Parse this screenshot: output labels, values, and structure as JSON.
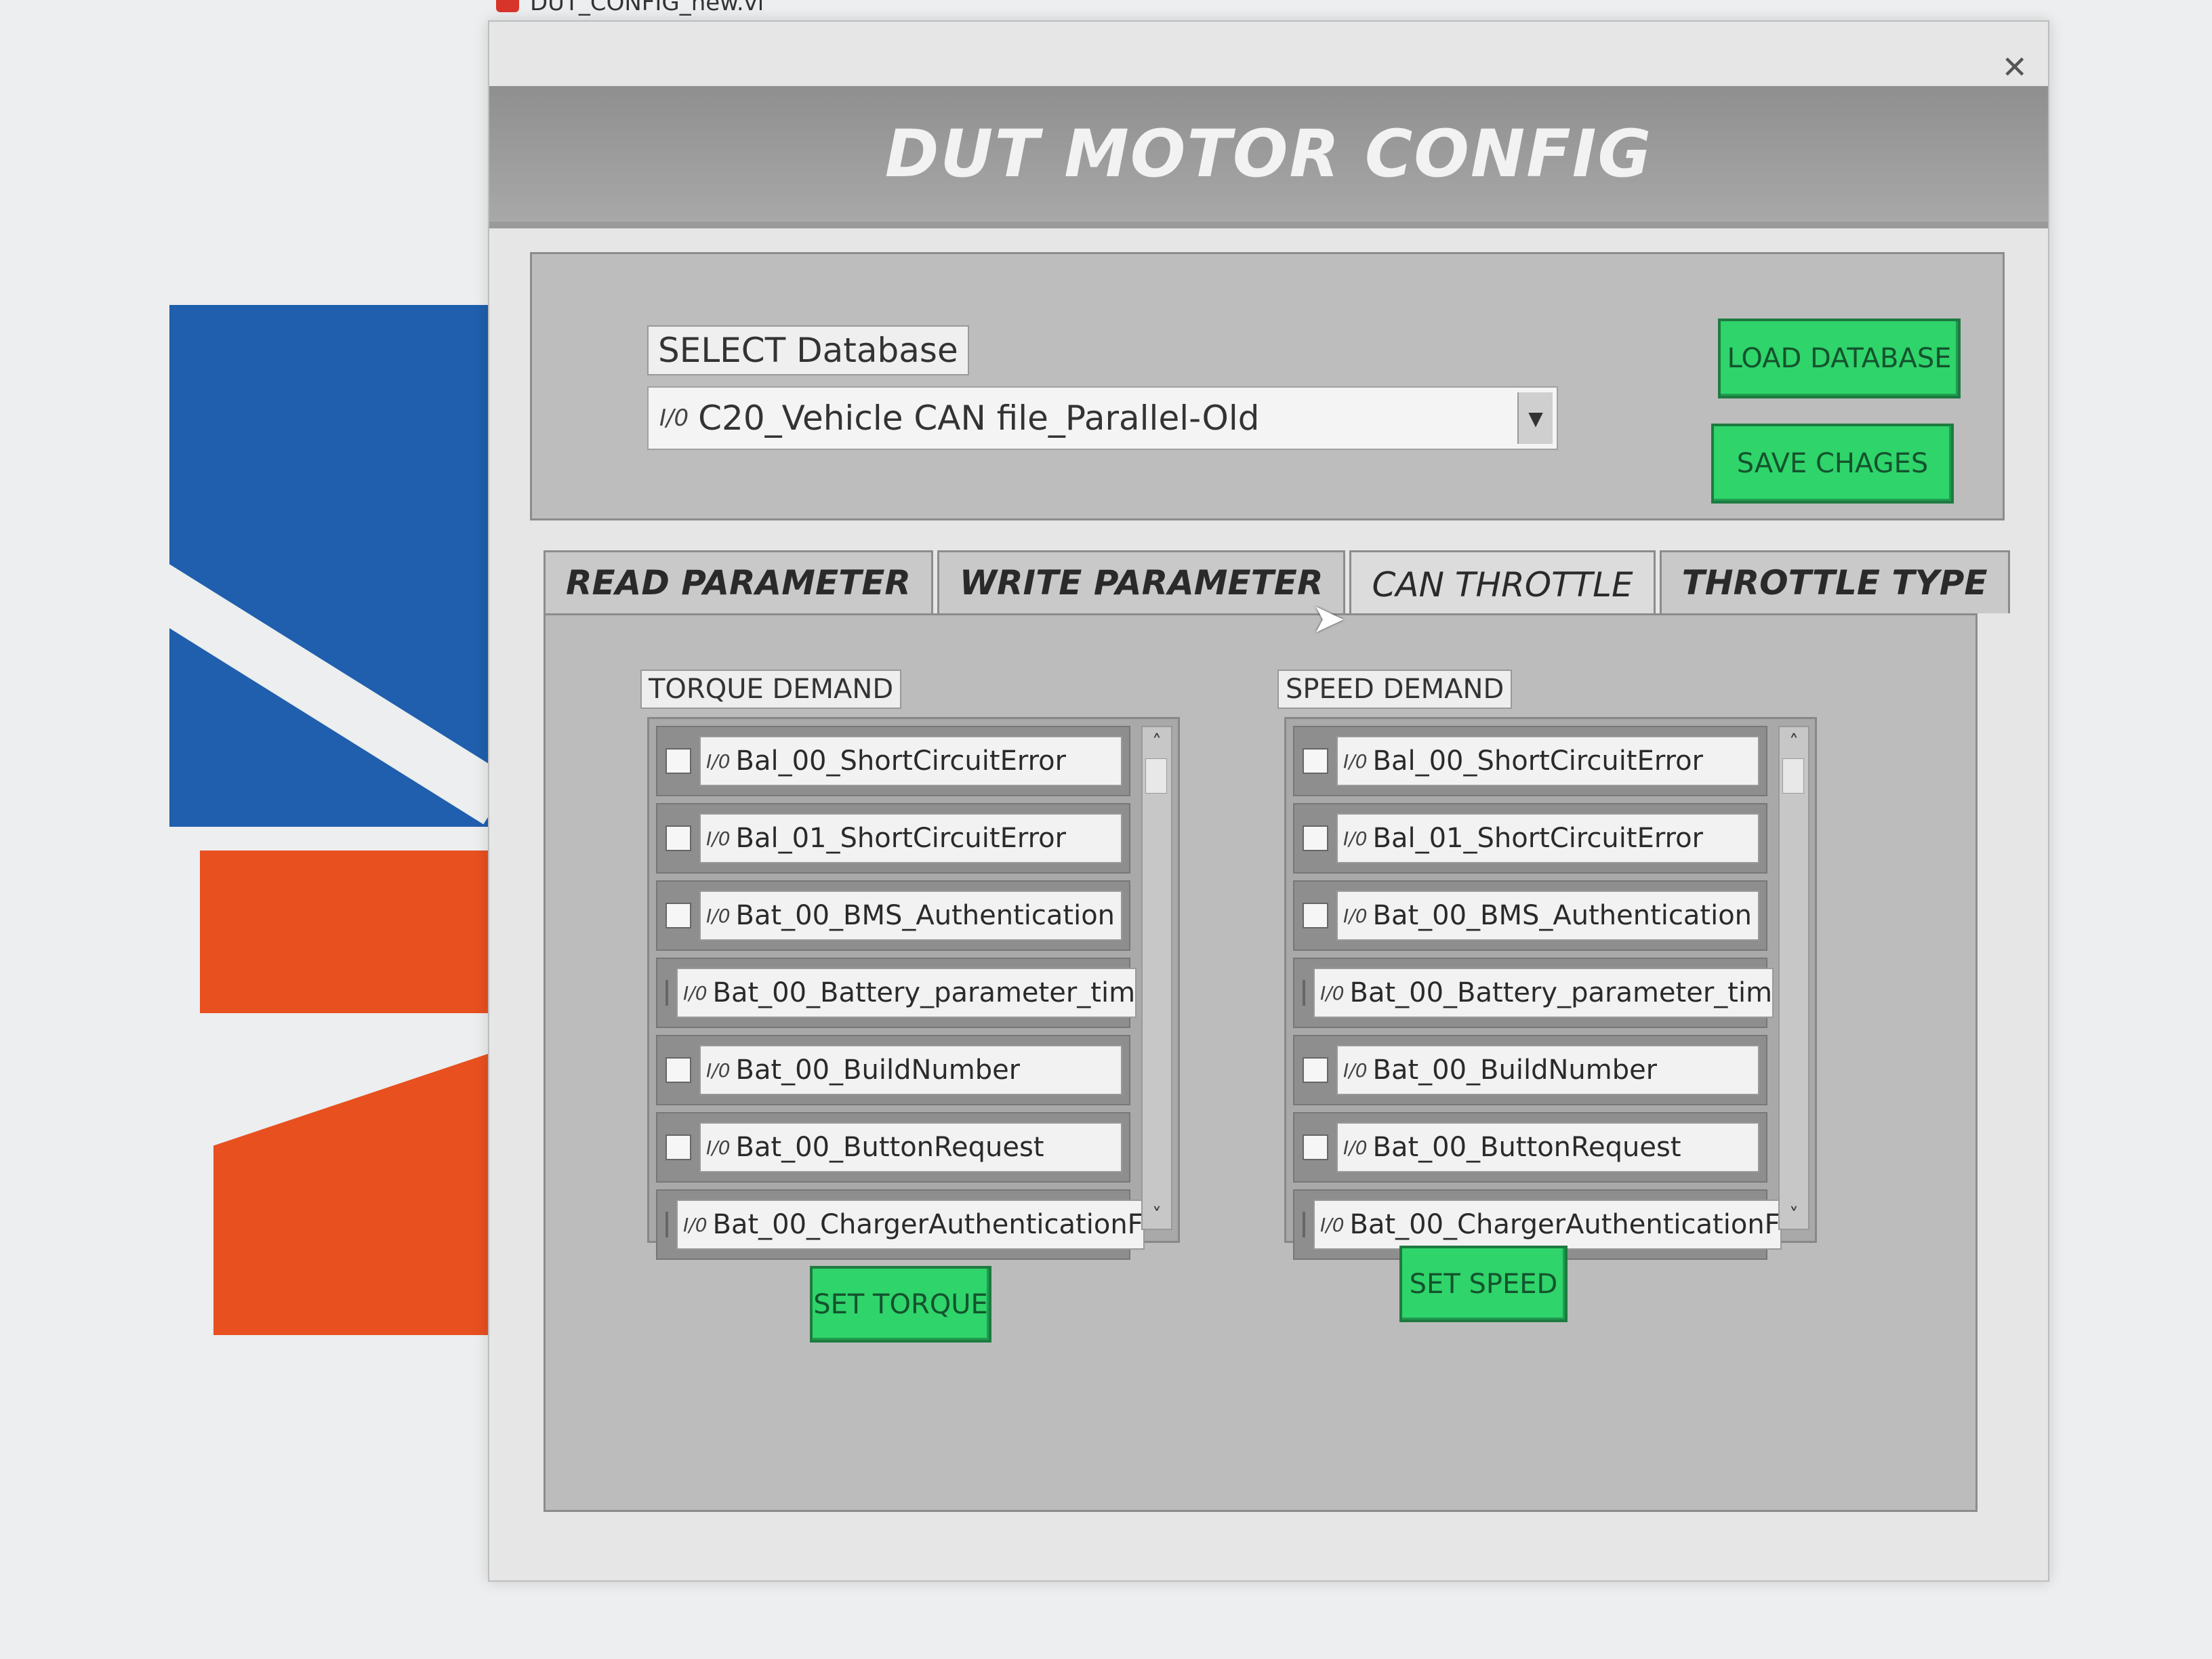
{
  "window": {
    "title": "DUT_CONFIG_new.vi",
    "close_icon": "close-icon"
  },
  "banner": {
    "title": "DUT MOTOR CONFIG"
  },
  "database": {
    "label": "SELECT Database",
    "selected": "C20_Vehicle CAN file_Parallel-Old",
    "load_label": "LOAD DATABASE",
    "save_label": "SAVE CHAGES"
  },
  "tabs": [
    {
      "label": "READ PARAMETER",
      "active": false
    },
    {
      "label": "WRITE PARAMETER",
      "active": false
    },
    {
      "label": "CAN THROTTLE",
      "active": true
    },
    {
      "label": "THROTTLE TYPE",
      "active": false
    }
  ],
  "torque": {
    "label": "TORQUE DEMAND",
    "items": [
      "Bal_00_ShortCircuitError",
      "Bal_01_ShortCircuitError",
      "Bat_00_BMS_Authentication",
      "Bat_00_Battery_parameter_tim",
      "Bat_00_BuildNumber",
      "Bat_00_ButtonRequest",
      "Bat_00_ChargerAuthenticationF"
    ],
    "button_label": "SET TORQUE"
  },
  "speed": {
    "label": "SPEED DEMAND",
    "items": [
      "Bal_00_ShortCircuitError",
      "Bal_01_ShortCircuitError",
      "Bat_00_BMS_Authentication",
      "Bat_00_Battery_parameter_tim",
      "Bat_00_BuildNumber",
      "Bat_00_ButtonRequest",
      "Bat_00_ChargerAuthenticationF"
    ],
    "button_label": "SET SPEED"
  },
  "glyphs": {
    "io": "I/0",
    "dropdown": "▼",
    "scroll_up": "˄",
    "scroll_down": "˅",
    "close": "✕"
  }
}
